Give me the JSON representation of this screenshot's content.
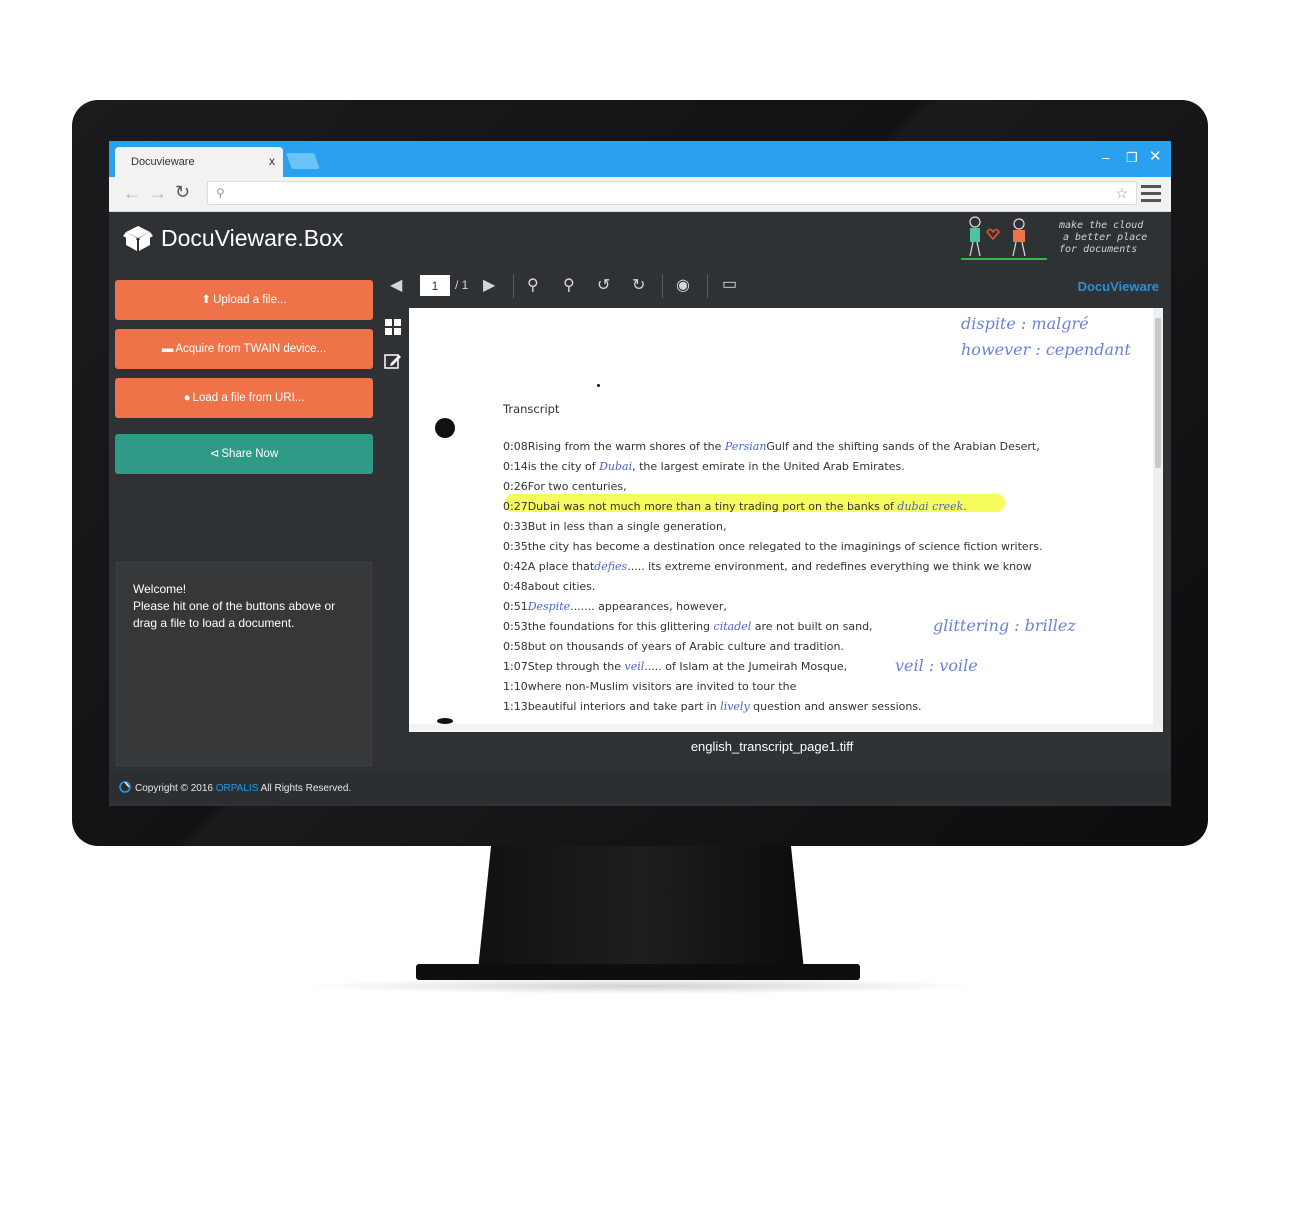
{
  "browser": {
    "tab_title": "Docuvieware",
    "tab_close": "x",
    "address_value": "",
    "address_placeholder": ""
  },
  "app": {
    "title": "DocuVieware.Box",
    "slogan": [
      "make the cloud",
      "a better place",
      "for documents"
    ]
  },
  "sidebar": {
    "buttons": [
      {
        "label": "Upload a file...",
        "icon": "upload-icon",
        "color": "#ef7249"
      },
      {
        "label": "Acquire from TWAIN device...",
        "icon": "scanner-icon",
        "color": "#ef7249"
      },
      {
        "label": "Load a file from URI...",
        "icon": "globe-icon",
        "color": "#ef7249"
      },
      {
        "label": "Share Now",
        "icon": "share-icon",
        "color": "#2f9b86"
      }
    ],
    "welcome": [
      "Welcome!",
      "Please hit one of the buttons above or",
      "drag a file to load a document."
    ]
  },
  "viewer": {
    "page_current": "1",
    "page_total": "/ 1",
    "brand": "DocuVieware",
    "filename": "english_transcript_page1.tiff",
    "document": {
      "title": "Transcript",
      "lines": [
        {
          "pre": "0:08Rising from the warm shores of the ",
          "hand": "Persian",
          "post": "Gulf and the shifting sands of the Arabian Desert,"
        },
        {
          "pre": "0:14is the city of ",
          "hand": "Dubai",
          "post": ", the largest emirate in the United Arab Emirates."
        },
        {
          "pre": "0:26For two centuries,",
          "hand": "",
          "post": ""
        },
        {
          "pre": "0:27Dubai was not much more than a tiny trading port on the banks of ",
          "hand": "dubai creek",
          "post": "."
        },
        {
          "pre": "0:33But in less than a single generation,",
          "hand": "",
          "post": ""
        },
        {
          "pre": "0:35the city has become a destination once relegated to the imaginings of science fiction writers.",
          "hand": "",
          "post": ""
        },
        {
          "pre": "0:42A place that",
          "hand": "defies",
          "post": "..... its extreme environment, and redefines everything we think we know"
        },
        {
          "pre": "0:48about cities.",
          "hand": "",
          "post": ""
        },
        {
          "pre": "0:51",
          "hand": "Despite",
          "post": "....... appearances, however,"
        },
        {
          "pre": "0:53the foundations for this glittering ",
          "hand": "citadel",
          "post": " are not built on sand,"
        },
        {
          "pre": "0:58but on thousands of years of Arabic culture and tradition.",
          "hand": "",
          "post": ""
        },
        {
          "pre": "1:07Step through the ",
          "hand": "veil",
          "post": "..... of Islam at the Jumeirah Mosque,"
        },
        {
          "pre": "1:10where non-Muslim visitors are invited to tour the",
          "hand": "",
          "post": ""
        },
        {
          "pre": "1:13beautiful interiors and take part in ",
          "hand": "lively",
          "post": " question and answer sessions."
        }
      ],
      "notes": [
        "dispite : malgré",
        "however : cependant",
        "glittering : brillez",
        "veil : voile"
      ]
    }
  },
  "footer": {
    "copyright": "Copyright © 2016 ",
    "company": "ORPALIS",
    "rights": " All Rights Reserved."
  }
}
